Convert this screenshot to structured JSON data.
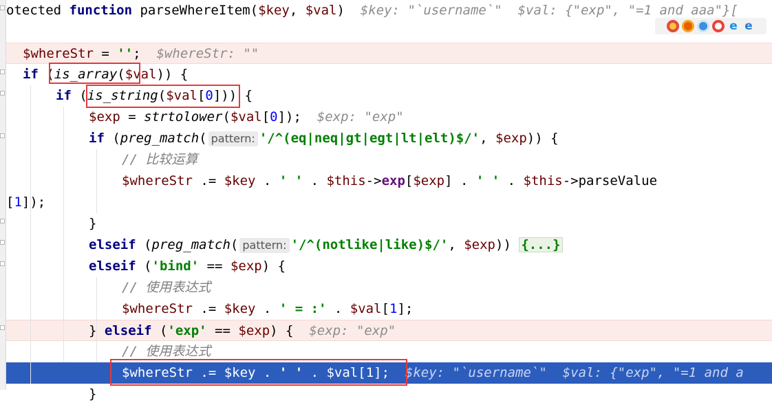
{
  "editor": {
    "lines": [
      {
        "id": "l1",
        "segments": [
          [
            "plain",
            "otected "
          ],
          [
            "kw",
            "function "
          ],
          [
            "plain",
            "parseWhereItem("
          ],
          [
            "var",
            "$key"
          ],
          [
            "plain",
            ", "
          ],
          [
            "var",
            "$val"
          ],
          [
            "plain",
            ")  "
          ],
          [
            "hint",
            "$key: \"`username`\"  $val: {\"exp\", \"=1 and aaa\"}["
          ]
        ]
      },
      {
        "id": "l2",
        "segments": []
      },
      {
        "id": "l3",
        "segments": [
          [
            "var",
            "$whereStr"
          ],
          [
            "plain",
            " = "
          ],
          [
            "str",
            "''"
          ],
          [
            "plain",
            ";  "
          ],
          [
            "hint",
            "$whereStr: \"\""
          ]
        ]
      },
      {
        "id": "l4",
        "segments": [
          [
            "kw",
            "if "
          ],
          [
            "plain",
            "("
          ],
          [
            "fn",
            "is_array"
          ],
          [
            "plain",
            "("
          ],
          [
            "var",
            "$val"
          ],
          [
            "plain",
            ")) {"
          ]
        ]
      },
      {
        "id": "l5",
        "segments": [
          [
            "kw",
            "if "
          ],
          [
            "plain",
            "("
          ],
          [
            "fn",
            "is_string"
          ],
          [
            "plain",
            "("
          ],
          [
            "var",
            "$val"
          ],
          [
            "plain",
            "["
          ],
          [
            "num",
            "0"
          ],
          [
            "plain",
            "])) {"
          ]
        ]
      },
      {
        "id": "l6",
        "segments": [
          [
            "var",
            "$exp"
          ],
          [
            "plain",
            " = "
          ],
          [
            "fn",
            "strtolower"
          ],
          [
            "plain",
            "("
          ],
          [
            "var",
            "$val"
          ],
          [
            "plain",
            "["
          ],
          [
            "num",
            "0"
          ],
          [
            "plain",
            "]);  "
          ],
          [
            "hint",
            "$exp: \"exp\""
          ]
        ]
      },
      {
        "id": "l7",
        "segments": [
          [
            "kw",
            "if "
          ],
          [
            "plain",
            "("
          ],
          [
            "fn",
            "preg_match"
          ],
          [
            "plain",
            "("
          ],
          [
            "tag",
            "pattern:"
          ],
          [
            "str",
            "'/^(eq|neq|gt|egt|lt|elt)$/'"
          ],
          [
            "plain",
            ", "
          ],
          [
            "var",
            "$exp"
          ],
          [
            "plain",
            ")) {"
          ]
        ]
      },
      {
        "id": "l8",
        "segments": [
          [
            "cm",
            "// 比较运算"
          ]
        ]
      },
      {
        "id": "l9",
        "segments": [
          [
            "var",
            "$whereStr"
          ],
          [
            "plain",
            " .= "
          ],
          [
            "var",
            "$key"
          ],
          [
            "plain",
            " . "
          ],
          [
            "str",
            "' '"
          ],
          [
            "plain",
            " . "
          ],
          [
            "var",
            "$this"
          ],
          [
            "plain",
            "->"
          ],
          [
            "prop",
            "exp"
          ],
          [
            "plain",
            "["
          ],
          [
            "var",
            "$exp"
          ],
          [
            "plain",
            "] . "
          ],
          [
            "str",
            "' '"
          ],
          [
            "plain",
            " . "
          ],
          [
            "var",
            "$this"
          ],
          [
            "plain",
            "->parseValue"
          ]
        ]
      },
      {
        "id": "l10",
        "segments": [
          [
            "plain",
            "["
          ],
          [
            "num",
            "1"
          ],
          [
            "plain",
            "]);"
          ]
        ]
      },
      {
        "id": "l11",
        "segments": [
          [
            "plain",
            "}"
          ]
        ]
      },
      {
        "id": "l12",
        "segments": [
          [
            "kw",
            "elseif "
          ],
          [
            "plain",
            "("
          ],
          [
            "fn",
            "preg_match"
          ],
          [
            "plain",
            "("
          ],
          [
            "tag",
            "pattern:"
          ],
          [
            "str",
            "'/^(notlike|like)$/'"
          ],
          [
            "plain",
            ", "
          ],
          [
            "var",
            "$exp"
          ],
          [
            "plain",
            ")) "
          ],
          [
            "fold",
            "{...}"
          ]
        ]
      },
      {
        "id": "l13",
        "segments": [
          [
            "kw",
            "elseif "
          ],
          [
            "plain",
            "("
          ],
          [
            "str",
            "'bind'"
          ],
          [
            "plain",
            " == "
          ],
          [
            "var",
            "$exp"
          ],
          [
            "plain",
            ") {"
          ]
        ]
      },
      {
        "id": "l14",
        "segments": [
          [
            "cm",
            "// 使用表达式"
          ]
        ]
      },
      {
        "id": "l15",
        "segments": [
          [
            "var",
            "$whereStr"
          ],
          [
            "plain",
            " .= "
          ],
          [
            "var",
            "$key"
          ],
          [
            "plain",
            " . "
          ],
          [
            "str",
            "' = :'"
          ],
          [
            "plain",
            " . "
          ],
          [
            "var",
            "$val"
          ],
          [
            "plain",
            "["
          ],
          [
            "num",
            "1"
          ],
          [
            "plain",
            "];"
          ]
        ]
      },
      {
        "id": "l16",
        "segments": [
          [
            "plain",
            "} "
          ],
          [
            "kw",
            "elseif "
          ],
          [
            "plain",
            "("
          ],
          [
            "str",
            "'exp'"
          ],
          [
            "plain",
            " == "
          ],
          [
            "var",
            "$exp"
          ],
          [
            "plain",
            ") {  "
          ],
          [
            "hint",
            "$exp: \"exp\""
          ]
        ]
      },
      {
        "id": "l17",
        "segments": [
          [
            "cm",
            "// 使用表达式"
          ]
        ]
      },
      {
        "id": "l18",
        "segments": [
          [
            "var",
            "$whereStr"
          ],
          [
            "plain",
            " .= "
          ],
          [
            "var",
            "$key"
          ],
          [
            "plain",
            " . "
          ],
          [
            "str",
            "' '"
          ],
          [
            "plain",
            " . "
          ],
          [
            "var",
            "$val"
          ],
          [
            "plain",
            "["
          ],
          [
            "num",
            "1"
          ],
          [
            "plain",
            "];  "
          ],
          [
            "hint",
            "$key: \"`username`\"  $val: {\"exp\", \"=1 and a"
          ]
        ]
      },
      {
        "id": "l19",
        "segments": [
          [
            "plain",
            "}"
          ]
        ]
      }
    ]
  },
  "browser_icons": [
    "chrome-icon",
    "firefox-icon",
    "safari-icon",
    "opera-icon",
    "ie-icon",
    "edge-icon"
  ]
}
